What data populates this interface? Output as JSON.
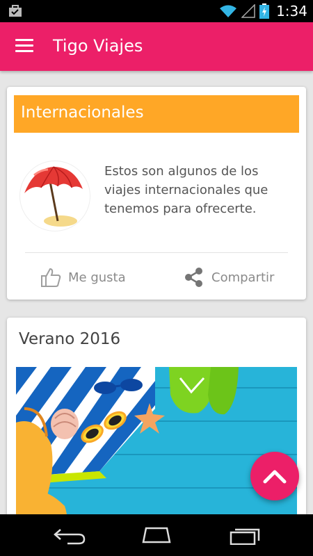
{
  "status_bar": {
    "time": "1:34",
    "icons": [
      "briefcase-notification-icon",
      "wifi-icon",
      "signal-icon",
      "battery-charging-icon"
    ]
  },
  "app_bar": {
    "title": "Tigo Viajes",
    "menu_icon": "hamburger-menu-icon",
    "color": "#ec1f68"
  },
  "card_internacionales": {
    "header_title": "Internacionales",
    "header_color": "#ffa726",
    "avatar_icon": "beach-umbrella-icon",
    "description": "Estos son algunos de los viajes internacionales que tenemos para ofrecerte.",
    "actions": [
      {
        "label": "Me gusta",
        "icon": "thumbs-up-icon"
      },
      {
        "label": "Compartir",
        "icon": "share-icon"
      }
    ]
  },
  "card_verano": {
    "title": "Verano 2016",
    "image": "beach-items-photo"
  },
  "fab": {
    "icon": "chevron-up-icon"
  },
  "nav_bar": {
    "buttons": [
      "back-icon",
      "home-icon",
      "recents-icon"
    ]
  }
}
